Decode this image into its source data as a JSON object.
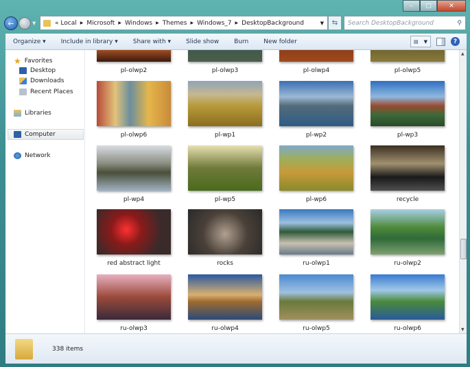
{
  "window": {
    "minimize": "–",
    "maximize": "□",
    "close": "✕"
  },
  "address": {
    "path": [
      "«",
      "Local",
      "Microsoft",
      "Windows",
      "Themes",
      "Windows_7",
      "DesktopBackground"
    ]
  },
  "search": {
    "placeholder": "Search DesktopBackground"
  },
  "toolbar": {
    "organize": "Organize ▾",
    "include": "Include in library ▾",
    "share": "Share with ▾",
    "slideshow": "Slide show",
    "burn": "Burn",
    "newfolder": "New folder"
  },
  "sidebar": {
    "favorites": "Favorites",
    "desktop": "Desktop",
    "downloads": "Downloads",
    "recent": "Recent Places",
    "libraries": "Libraries",
    "computer": "Computer",
    "network": "Network"
  },
  "files": [
    {
      "name": "pl-olwp2",
      "bg": "linear-gradient(#7a2d12,#d8692a 60%,#3a1a10)"
    },
    {
      "name": "pl-olwp3",
      "bg": "linear-gradient(#2c4656,#4a5f4a)"
    },
    {
      "name": "pl-olwp4",
      "bg": "linear-gradient(#5a1f10,#a04a1c)"
    },
    {
      "name": "pl-olwp5",
      "bg": "linear-gradient(#2d2a18,#8a7a3a)"
    },
    {
      "name": "pl-olwp6",
      "bg": "linear-gradient(90deg,#b94a3a,#e2c37a 25%,#6b8f9e 45%,#e5b64a 70%,#c98a3a)"
    },
    {
      "name": "pl-wp1",
      "bg": "linear-gradient(#8ea3b8 0,#c5b890 30%,#b89a3a 55%,#8a6d20)"
    },
    {
      "name": "pl-wp2",
      "bg": "linear-gradient(#3a6fb3,#9cb9d4 35%,#556b7a 55%,#2d5b86)"
    },
    {
      "name": "pl-wp3",
      "bg": "linear-gradient(#2f6fc0,#8fb8e0 35%,#9a4a2f 55%,#3c6a3a 75%,#2b4a2a)"
    },
    {
      "name": "pl-wp4",
      "bg": "linear-gradient(#d8dde3,#8a8d80 40%,#4a4f3a 60%,#9fb0bf)"
    },
    {
      "name": "pl-wp5",
      "bg": "linear-gradient(#e8e0b0,#6f7a3a 50%,#4a6a1c)"
    },
    {
      "name": "pl-wp6",
      "bg": "linear-gradient(#7fa9c9,#9fae5a 30%,#c79a3a 60%,#8a8a2a)"
    },
    {
      "name": "recycle",
      "bg": "linear-gradient(#3a3020,#a09070 40%,#1a1a1a 70%,#505050)"
    },
    {
      "name": "red abstract light",
      "bg": "radial-gradient(circle at 40% 45%,#ff3030,#8a1a1a 30%,#3a2a2a 70%)"
    },
    {
      "name": "rocks",
      "bg": "radial-gradient(circle at 50% 55%,#b0a090,#4a4038 50%,#2a2a2a)"
    },
    {
      "name": "ru-olwp1",
      "bg": "linear-gradient(#3a78c0,#9cc0e0 30%,#2f5a3a 50%,#c8c0b0 75%,#6a7a8a)"
    },
    {
      "name": "ru-olwp2",
      "bg": "linear-gradient(#a8d0e8,#4f8a3a 40%,#2f6a3a 65%,#7fa070)"
    },
    {
      "name": "ru-olwp3",
      "bg": "linear-gradient(#e8b0c0,#9a4a3a 50%,#3a2a3a)"
    },
    {
      "name": "ru-olwp4",
      "bg": "linear-gradient(#2a5aa0,#d8b070 45%,#a06a30 60%,#2a4a7a)"
    },
    {
      "name": "ru-olwp5",
      "bg": "linear-gradient(#4a8ad0,#a0c0e0 40%,#6a7a3a 60%,#a09060)"
    },
    {
      "name": "ru-olwp6",
      "bg": "linear-gradient(#3a7ad0,#a0c8e8 35%,#4a8a3a 60%,#2a5a9a)"
    }
  ],
  "status": {
    "count": "338 items"
  }
}
